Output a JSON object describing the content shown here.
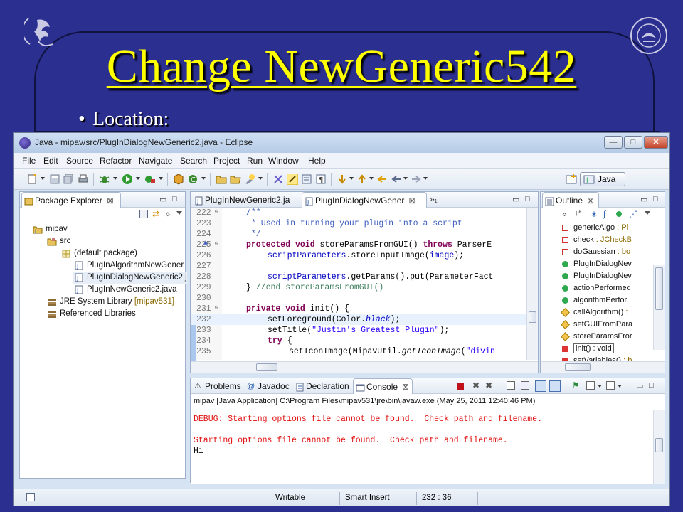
{
  "slide": {
    "title": "Change NewGeneric542",
    "bullet": "Location:"
  },
  "window": {
    "title": "Java - mipav/src/PlugInDialogNewGeneric2.java - Eclipse",
    "min_label": "—",
    "max_label": "□",
    "close_label": "✕"
  },
  "menu": [
    "File",
    "Edit",
    "Source",
    "Refactor",
    "Navigate",
    "Search",
    "Project",
    "Run",
    "Window",
    "Help"
  ],
  "perspective": {
    "label": "Java"
  },
  "package_explorer": {
    "tab": "Package Explorer",
    "tree": [
      {
        "label": "mipav",
        "icon": "project-icon"
      },
      {
        "label": "src",
        "icon": "source-folder-icon"
      },
      {
        "label": "(default package)",
        "icon": "package-icon"
      },
      {
        "label": "PlugInAlgorithmNewGener",
        "icon": "java-file-icon"
      },
      {
        "label": "PlugInDialogNewGeneric2.j",
        "icon": "java-file-icon"
      },
      {
        "label": "PlugInNewGeneric2.java",
        "icon": "java-file-icon"
      },
      {
        "label": "JRE System Library",
        "suffix": "[mipav531]",
        "icon": "library-icon"
      },
      {
        "label": "Referenced Libraries",
        "icon": "library-icon"
      }
    ]
  },
  "editor": {
    "tabs": [
      "PlugInNewGeneric2.ja",
      "PlugInDialogNewGener"
    ],
    "overflow": "»₁",
    "lines": [
      {
        "num": "222",
        "text": "/**"
      },
      {
        "num": "223",
        "text": " * Used in turning your plugin into a script"
      },
      {
        "num": "224",
        "text": " */"
      },
      {
        "num": "225",
        "text": "protected void storeParamsFromGUI() throws ParserE"
      },
      {
        "num": "226",
        "text": "scriptParameters.storeInputImage(image);"
      },
      {
        "num": "227",
        "text": ""
      },
      {
        "num": "228",
        "text": "scriptParameters.getParams().put(ParameterFact"
      },
      {
        "num": "229",
        "text": "} //end storeParamsFromGUI()"
      },
      {
        "num": "230",
        "text": ""
      },
      {
        "num": "231",
        "text": "private void init() {"
      },
      {
        "num": "232",
        "text": "setForeground(Color.black);"
      },
      {
        "num": "233",
        "text": "setTitle(\"Justin's Greatest Plugin\");"
      },
      {
        "num": "234",
        "text": "try {"
      },
      {
        "num": "235",
        "text": "setIconImage(MipavUtil.getIconImage(\"divin"
      }
    ]
  },
  "outline": {
    "tab": "Outline",
    "items": [
      {
        "name": "genericAlgo",
        "type": " : Pl"
      },
      {
        "name": "check",
        "type": " : JCheckB"
      },
      {
        "name": "doGaussian",
        "type": " : bo"
      },
      {
        "name": "PlugInDialogNev",
        "type": ""
      },
      {
        "name": "PlugInDialogNev",
        "type": ""
      },
      {
        "name": "actionPerformed",
        "type": ""
      },
      {
        "name": "algorithmPerfor",
        "type": ""
      },
      {
        "name": "callAlgorithm()",
        "type": " :"
      },
      {
        "name": "setGUIFromPara",
        "type": ""
      },
      {
        "name": "storeParamsFror",
        "type": ""
      },
      {
        "name": "init() : void",
        "type": ""
      },
      {
        "name": "setVariables()",
        "type": " : b"
      }
    ]
  },
  "bottom_tabs": [
    "Problems",
    "Javadoc",
    "Declaration",
    "Console"
  ],
  "console": {
    "header": "mipav [Java Application] C:\\Program Files\\mipav531\\jre\\bin\\javaw.exe (May 25, 2011 12:40:46 PM)",
    "lines": [
      "DEBUG: Starting options file cannot be found.  Check path and filename.",
      "",
      "Starting options file cannot be found.  Check path and filename.",
      "Hi"
    ]
  },
  "status": {
    "mode": "Writable",
    "insert": "Smart Insert",
    "position": "232 : 36"
  },
  "colors": {
    "slide_bg": "#2b2f8f",
    "title": "#ffff00",
    "keyword": "#7f0055",
    "comment": "#3f5fbf",
    "string": "#2a00ff",
    "console_error": "#e01010"
  }
}
